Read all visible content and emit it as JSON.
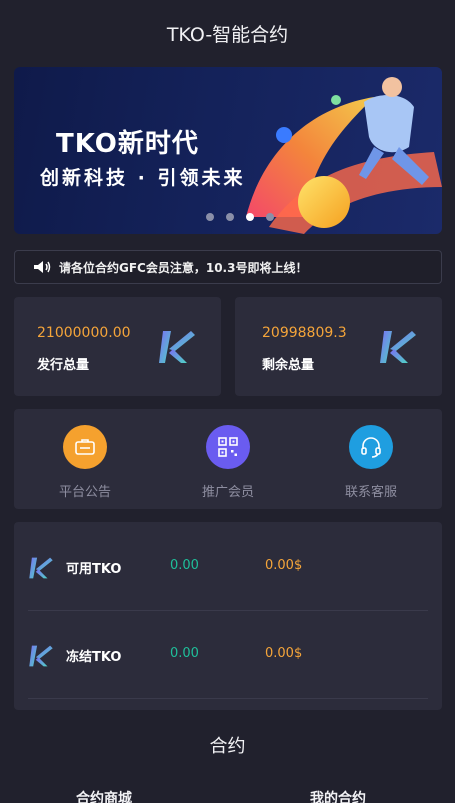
{
  "header": {
    "title": "TKO-智能合约"
  },
  "banner": {
    "title": "TKO新时代",
    "subtitle": "创新科技 · 引领未来",
    "dot_count": 4,
    "active_dot": 3
  },
  "notice": {
    "icon": "speaker-icon",
    "text": "请各位合约GFC会员注意，10.3号即将上线！"
  },
  "stats": [
    {
      "value": "21000000.00",
      "label": "发行总量",
      "icon": "tko-logo-icon"
    },
    {
      "value": "20998809.3",
      "label": "剩余总量",
      "icon": "tko-logo-icon"
    }
  ],
  "quick_links": [
    {
      "label": "平台公告",
      "icon": "announcement-icon",
      "color": "#f5a12e"
    },
    {
      "label": "推广会员",
      "icon": "qrcode-icon",
      "color": "#6a5cf0"
    },
    {
      "label": "联系客服",
      "icon": "headset-icon",
      "color": "#1f9ee0"
    }
  ],
  "assets": [
    {
      "name": "可用TKO",
      "amount": "0.00",
      "usd": "0.00$"
    },
    {
      "name": "冻结TKO",
      "amount": "0.00",
      "usd": "0.00$"
    }
  ],
  "contract": {
    "title": "合约",
    "tabs": [
      "合约商城",
      "我的合约"
    ]
  },
  "colors": {
    "background": "#21212d",
    "card": "#2c2c3b",
    "accent_orange": "#f5a53a",
    "accent_green": "#1fbf9a"
  }
}
